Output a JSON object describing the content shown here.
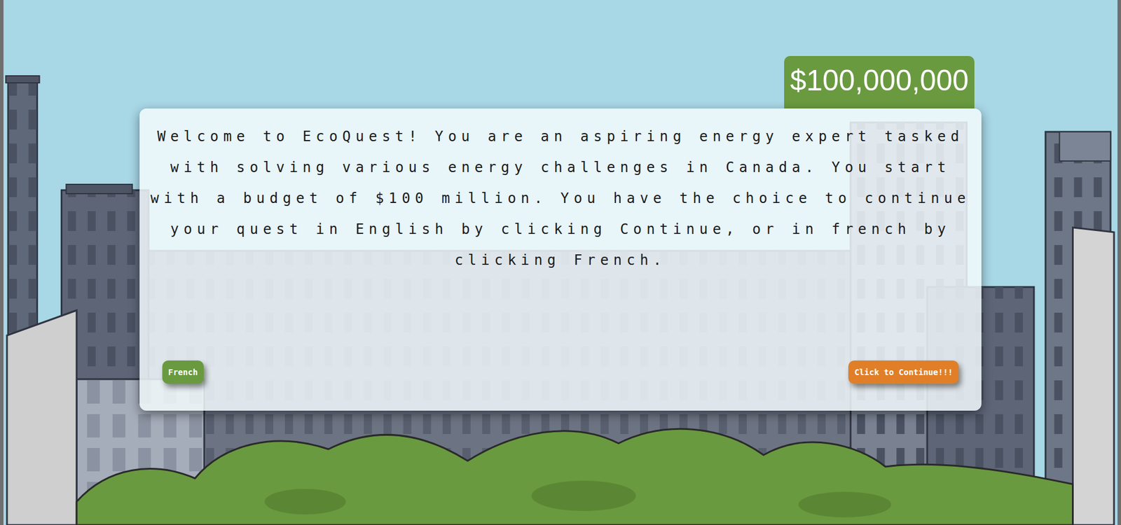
{
  "budget": {
    "amount": "$100,000,000"
  },
  "dialog": {
    "text": "Welcome to EcoQuest! You are an aspiring energy expert tasked with solving various energy challenges in Canada. You start with a budget of $100 million. You have the choice to continue your quest in English by clicking Continue, or in french by clicking French."
  },
  "buttons": [
    {
      "label": "French",
      "kind": "secondary"
    },
    {
      "label": "Click to Continue!!!",
      "kind": "primary"
    }
  ]
}
